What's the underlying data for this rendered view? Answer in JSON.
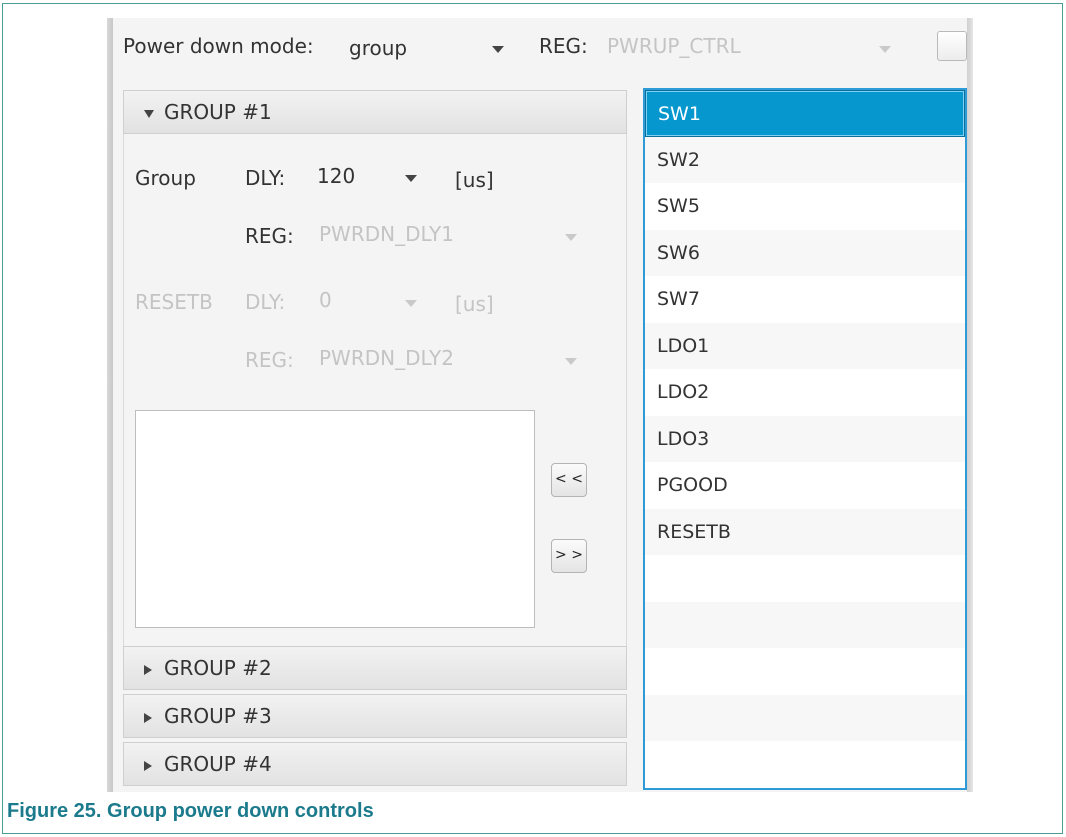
{
  "header": {
    "mode_label": "Power down mode:",
    "mode_value": "group",
    "reg_label": "REG:",
    "reg_value": "PWRUP_CTRL"
  },
  "group1": {
    "title": "GROUP #1",
    "group_label": "Group",
    "dly_label": "DLY:",
    "dly_value": "120",
    "unit": "[us]",
    "reg_label": "REG:",
    "reg_value": "PWRDN_DLY1",
    "resetb_label": "RESETB",
    "resetb_dly_label": "DLY:",
    "resetb_dly_value": "0",
    "resetb_unit": "[us]",
    "resetb_reg_label": "REG:",
    "resetb_reg_value": "PWRDN_DLY2"
  },
  "buttons": {
    "move_left": "< <",
    "move_right": "> >"
  },
  "groups": [
    {
      "title": "GROUP #2"
    },
    {
      "title": "GROUP #3"
    },
    {
      "title": "GROUP #4"
    }
  ],
  "list": {
    "items": [
      "SW1",
      "SW2",
      "SW5",
      "SW6",
      "SW7",
      "LDO1",
      "LDO2",
      "LDO3",
      "PGOOD",
      "RESETB"
    ],
    "selected": "SW1"
  },
  "caption": "Figure 25.  Group power down controls",
  "colors": {
    "frame": "#4a9e97",
    "selection": "#0697cf",
    "caption": "#1b7a8c"
  }
}
